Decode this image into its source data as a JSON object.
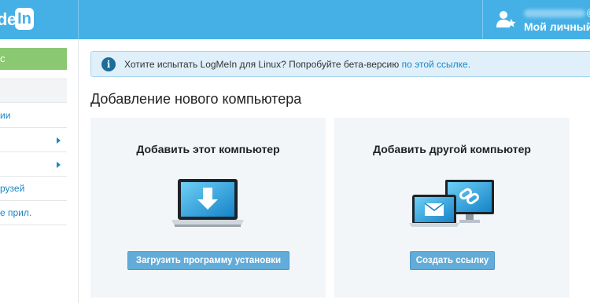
{
  "header": {
    "logo_text": "de",
    "logo_badge": "In",
    "user_email_tail": "@g",
    "user_menu_label": "Мой личный"
  },
  "sidebar": {
    "items": [
      {
        "label": "с",
        "style": "green"
      },
      {
        "label": "",
        "style": "active"
      },
      {
        "label": "ии",
        "style": "link"
      },
      {
        "label": "",
        "style": "expandable"
      },
      {
        "label": "",
        "style": "expandable"
      },
      {
        "label": "рузей",
        "style": "link"
      },
      {
        "label": "е прил.",
        "style": "link"
      }
    ]
  },
  "banner": {
    "text": "Хотите испытать LogMeIn для Linux? Попробуйте бета-версию ",
    "link_text": "по этой ссылке.",
    "icon": "info-icon"
  },
  "main": {
    "title": "Добавление нового компьютера",
    "cards": [
      {
        "title": "Добавить этот компьютер",
        "button_label": "Загрузить программу установки",
        "icon": "laptop-download-icon"
      },
      {
        "title": "Добавить другой компьютер",
        "button_label": "Создать ссылку",
        "icon": "devices-link-icon"
      }
    ]
  },
  "colors": {
    "header_blue": "#45b0e6",
    "accent_green": "#8bc872",
    "button_blue": "#62acd9",
    "link_blue": "#1a87c8"
  }
}
